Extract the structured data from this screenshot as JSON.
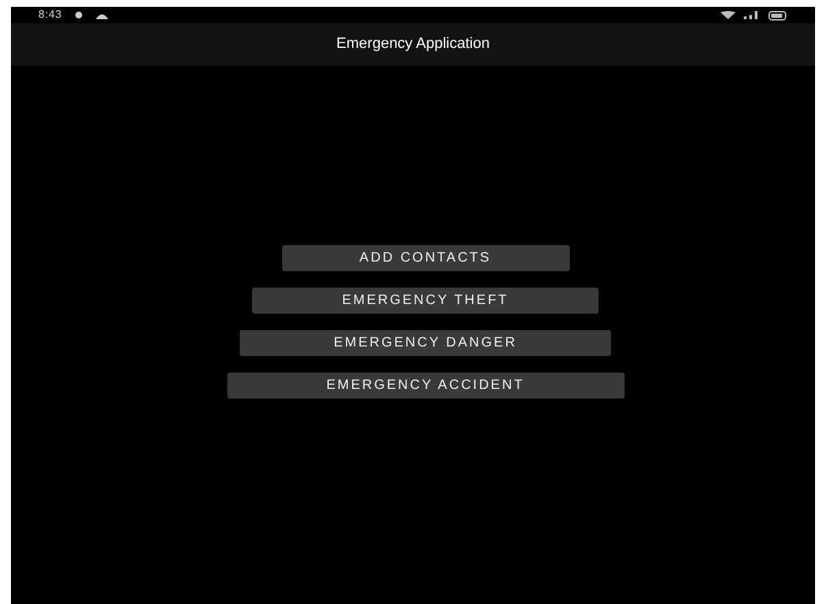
{
  "status_bar": {
    "time": "8:43"
  },
  "app_bar": {
    "title": "Emergency Application"
  },
  "buttons": [
    {
      "label": "ADD CONTACTS"
    },
    {
      "label": "EMERGENCY THEFT"
    },
    {
      "label": "EMERGENCY DANGER"
    },
    {
      "label": "EMERGENCY ACCIDENT"
    }
  ]
}
